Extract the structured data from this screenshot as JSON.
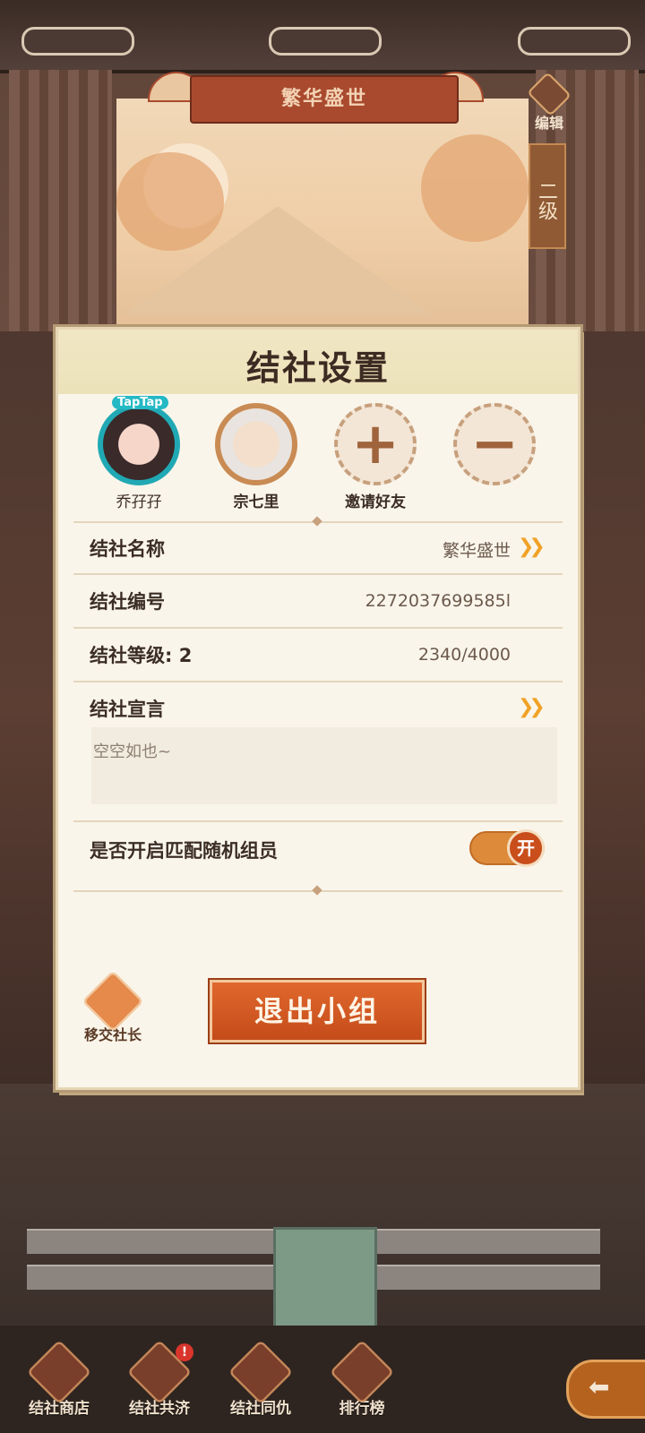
{
  "header": {
    "banner_title": "繁华盛世",
    "edit_label": "编辑",
    "level_tag": "二级"
  },
  "dialog": {
    "title": "结社设置",
    "members": [
      {
        "name": "乔孖孖",
        "badge": "TapTap"
      },
      {
        "name": "宗七里"
      }
    ],
    "invite_label": "邀请好友",
    "rows": {
      "name_label": "结社名称",
      "name_value": "繁华盛世",
      "id_label": "结社编号",
      "id_value": "2272037699585l",
      "level_label": "结社等级: 2",
      "level_progress": "2340/4000",
      "manifesto_label": "结社宣言",
      "manifesto_text": "空空如也~",
      "random_match_label": "是否开启匹配随机组员",
      "random_match_toggle": "开"
    },
    "transfer_label": "移交社长",
    "quit_label": "退出小组"
  },
  "bottom_nav": [
    {
      "label": "结社商店",
      "icon": "shop-icon"
    },
    {
      "label": "结社共济",
      "icon": "aid-icon",
      "badge": "!"
    },
    {
      "label": "结社同仇",
      "icon": "battle-icon"
    },
    {
      "label": "排行榜",
      "icon": "ranking-icon"
    }
  ],
  "colors": {
    "accent": "#dd8a3b",
    "brand_red": "#a94a2e",
    "dialog_bg": "#faf5ea"
  }
}
